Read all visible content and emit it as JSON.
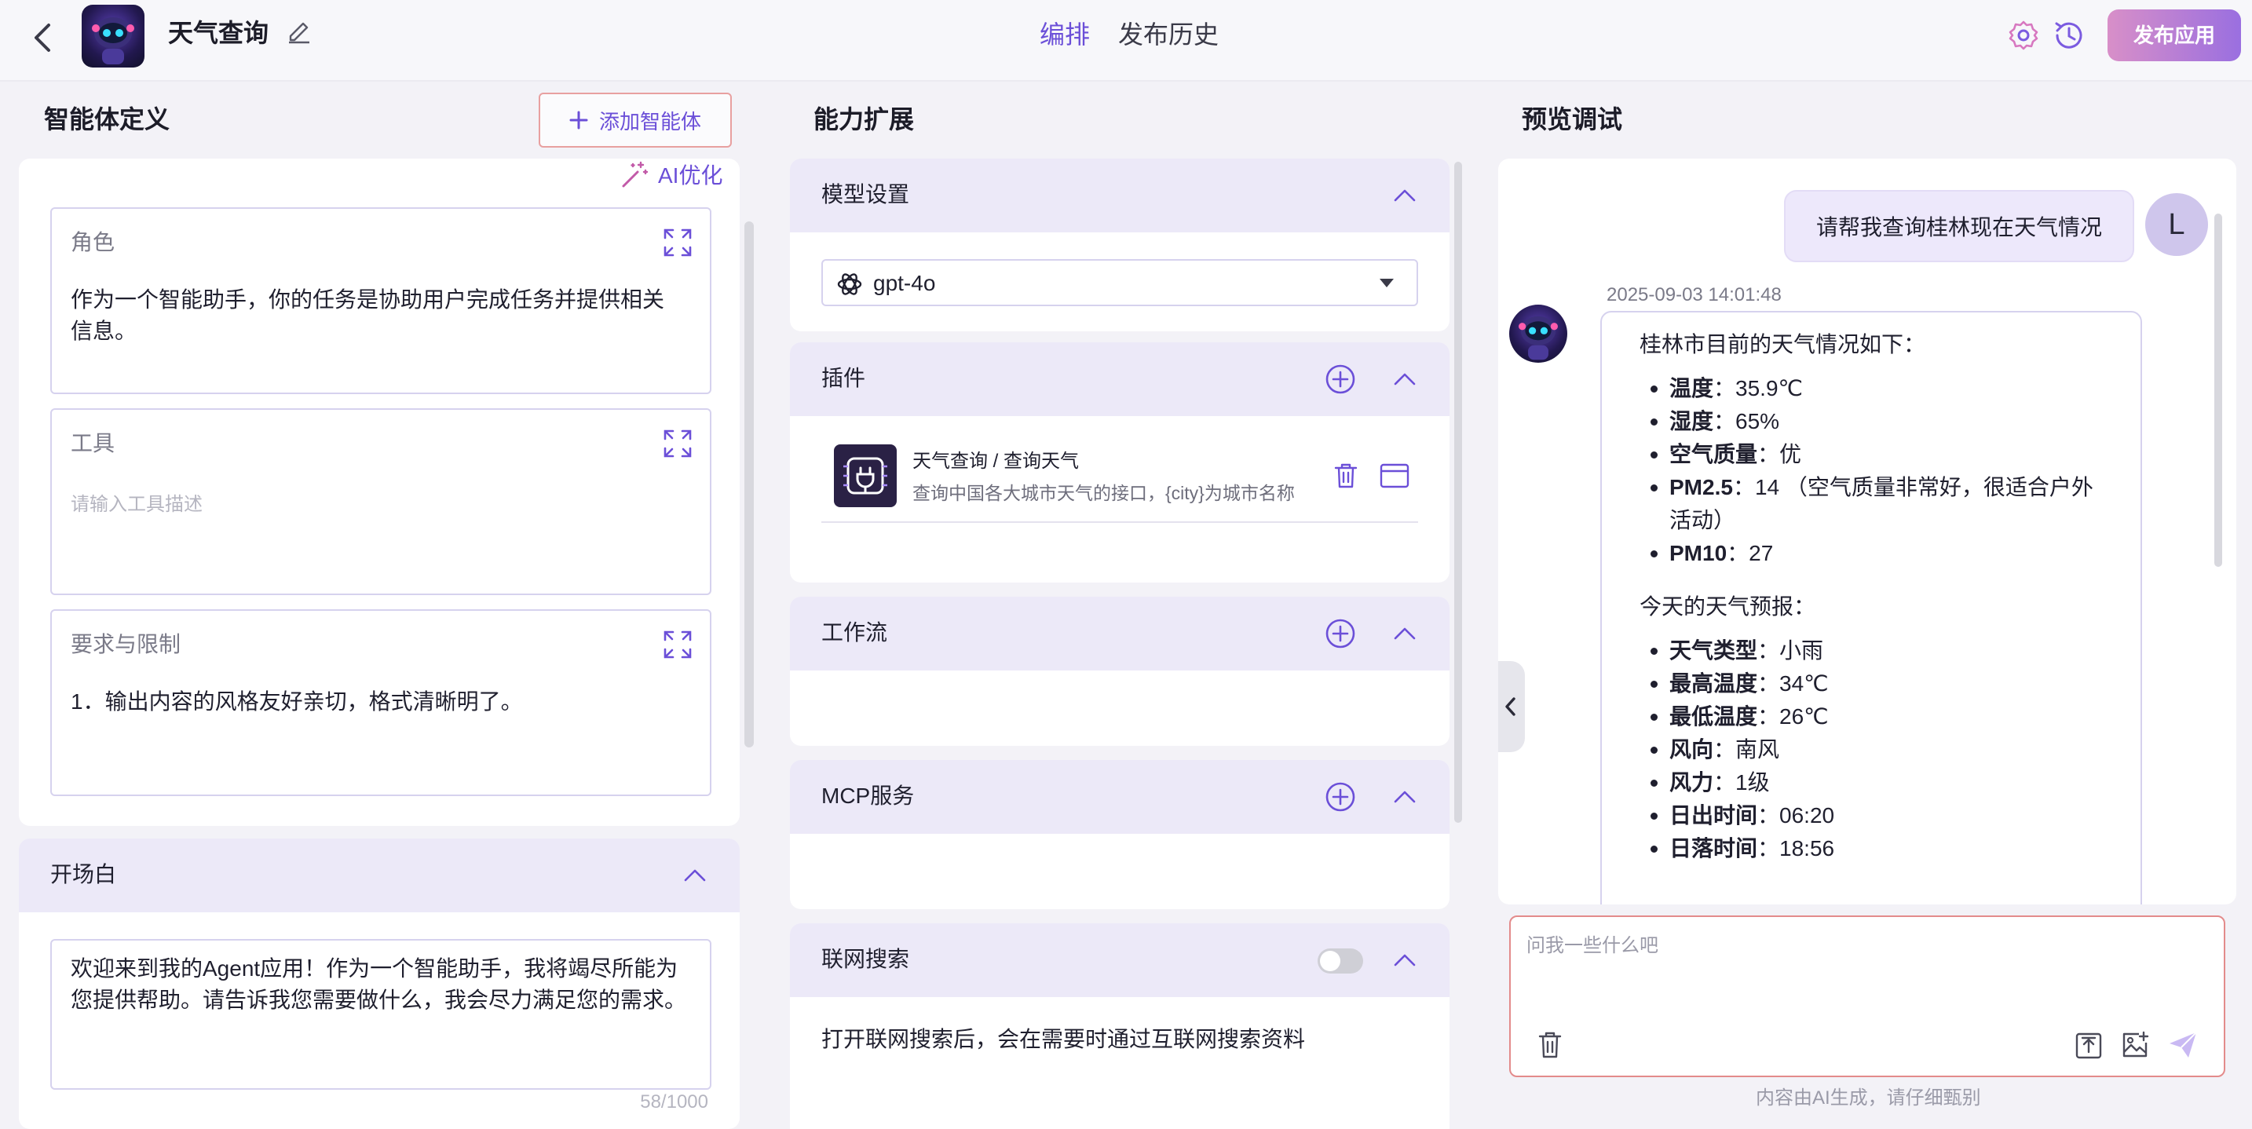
{
  "header": {
    "app_title": "天气查询",
    "tabs": [
      {
        "label": "编排",
        "active": true
      },
      {
        "label": "发布历史",
        "active": false
      }
    ],
    "publish_label": "发布应用"
  },
  "left": {
    "title": "智能体定义",
    "add_agent_label": "添加智能体",
    "ai_optimize_label": "AI优化",
    "cards": {
      "role": {
        "title": "角色",
        "text": "作为一个智能助手，你的任务是协助用户完成任务并提供相关信息。"
      },
      "tools": {
        "title": "工具",
        "placeholder": "请输入工具描述"
      },
      "requirements": {
        "title": "要求与限制",
        "text": "1．输出内容的风格友好亲切，格式清晰明了。"
      }
    },
    "opening": {
      "title": "开场白",
      "text": "欢迎来到我的Agent应用！作为一个智能助手，我将竭尽所能为您提供帮助。请告诉我您需要做什么，我会尽力满足您的需求。",
      "char_count": "58/1000"
    }
  },
  "middle": {
    "title": "能力扩展",
    "model": {
      "title": "模型设置",
      "value": "gpt-4o"
    },
    "plugins": {
      "title": "插件",
      "items": [
        {
          "name": "天气查询 / 查询天气",
          "description": "查询中国各大城市天气的接口，{city}为城市名称"
        }
      ]
    },
    "workflow": {
      "title": "工作流"
    },
    "mcp": {
      "title": "MCP服务"
    },
    "web_search": {
      "title": "联网搜索",
      "enabled": false,
      "description": "打开联网搜索后，会在需要时通过互联网搜索资料"
    }
  },
  "right": {
    "title": "预览调试",
    "user_message": "请帮我查询桂林现在天气情况",
    "user_initial": "L",
    "bot": {
      "timestamp": "2025-09-03 14:01:48",
      "intro": "桂林市目前的天气情况如下：",
      "current": [
        {
          "label": "温度",
          "value": "：35.9℃"
        },
        {
          "label": "湿度",
          "value": "：65%"
        },
        {
          "label": "空气质量",
          "value": "：优"
        },
        {
          "label": "PM2.5",
          "value": "：14 （空气质量非常好，很适合户外活动）"
        },
        {
          "label": "PM10",
          "value": "：27"
        }
      ],
      "forecast_title": "今天的天气预报：",
      "forecast": [
        {
          "label": "天气类型",
          "value": "：小雨"
        },
        {
          "label": "最高温度",
          "value": "：34℃"
        },
        {
          "label": "最低温度",
          "value": "：26℃"
        },
        {
          "label": "风向",
          "value": "：南风"
        },
        {
          "label": "风力",
          "value": "：1级"
        },
        {
          "label": "日出时间",
          "value": "：06:20"
        },
        {
          "label": "日落时间",
          "value": "：18:56"
        }
      ]
    },
    "input_placeholder": "问我一些什么吧",
    "disclaimer": "内容由AI生成，请仔细甄别"
  },
  "colors": {
    "accent": "#6b4fd8",
    "section_header": "#ece9f8",
    "publish_gradient_start": "#d88fc8",
    "publish_gradient_end": "#9a6fe0",
    "input_border": "#e38b8b"
  },
  "icons": [
    "back-icon",
    "edit-icon",
    "settings-icon",
    "history-icon",
    "plus-icon",
    "magic-wand-icon",
    "expand-icon",
    "chevron-up-icon",
    "openai-icon",
    "caret-down-icon",
    "plugin-icon",
    "trash-icon",
    "card-icon",
    "chevron-left-icon",
    "upload-icon",
    "image-icon",
    "send-icon"
  ]
}
